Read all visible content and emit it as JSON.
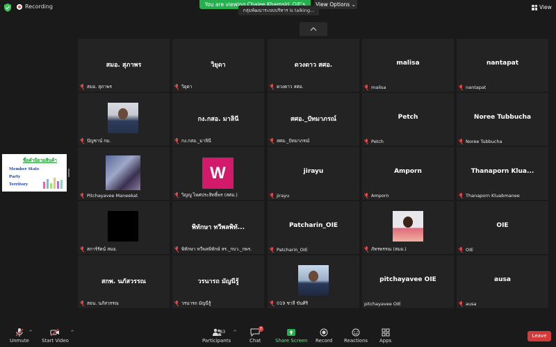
{
  "topbar": {
    "recording_label": "Recording",
    "viewing_banner": "You are viewing Chalee Khamsiri_OIE's screen",
    "view_options_label": "View Options",
    "speaker_tip": "กลุ่มพัฒนาระบบบริหาร is talking...",
    "view_button_label": "View"
  },
  "shared_screen": {
    "title": "ชื่อคำนิยามสินค้า",
    "lines": [
      "Member State",
      "Party",
      "Territory"
    ]
  },
  "tiles": [
    {
      "name": "สมอ. สุภาพร",
      "label": "สมอ. สุภาพร",
      "photo": null
    },
    {
      "name": "วิยุดา",
      "label": "วิยุดา",
      "photo": null
    },
    {
      "name": "ดวงดาว สศอ.",
      "label": "ดวงดาว สศอ.",
      "photo": null
    },
    {
      "name": "malisa",
      "label": "malisa",
      "photo": null
    },
    {
      "name": "nantapat",
      "label": "nantapat",
      "photo": null
    },
    {
      "name": "",
      "label": "ปัญชาน์ กม.",
      "photo": "woman"
    },
    {
      "name": "กง.กสอ. มาลินี",
      "label": "กง.กสอ._มาลินี",
      "photo": null
    },
    {
      "name": "สศอ._ปัทมาภรณ์",
      "label": "สศอ._ปัทมาภรณ์",
      "photo": null
    },
    {
      "name": "Petch",
      "label": "Petch",
      "photo": null
    },
    {
      "name": "Noree Tubbucha",
      "label": "Noree Tubbucha",
      "photo": null
    },
    {
      "name": "",
      "label": "Pitchayavee Maneekat",
      "photo": "group"
    },
    {
      "name": "",
      "label": "วิญญู ไพศประสิทธิ์พร (สศอ.)",
      "photo": "W"
    },
    {
      "name": "jirayu",
      "label": "jirayu",
      "photo": null
    },
    {
      "name": "Amporn",
      "label": "Amporn",
      "photo": null
    },
    {
      "name": "Thanaporn  Klua...",
      "label": "Thanaporn Kluabmanee",
      "photo": null
    },
    {
      "name": "",
      "label": "สการ์รัตน์ สมอ.",
      "photo": "black"
    },
    {
      "name": "พิทักษา ทวีพลพิทั...",
      "label": "พิทักษา ทวีพลพิทักษ์ สร._กบว._กพร.",
      "photo": null
    },
    {
      "name": "Patcharin_OIE",
      "label": "Patcharin_OIE",
      "photo": null
    },
    {
      "name": "",
      "label": "ภัทรพรรณ (สมอ.)",
      "photo": "woman2"
    },
    {
      "name": "OIE",
      "label": "OIE",
      "photo": null
    },
    {
      "name": "สกพ. นภัสวรรณ",
      "label": "สอน. นภัสวรรณ",
      "photo": null
    },
    {
      "name": "วรนารถ มัญนีรู้",
      "label": "วรนารถ มัญนีรู้",
      "photo": null
    },
    {
      "name": "",
      "label": "019 ชาลี ขันศิริ",
      "photo": "man"
    },
    {
      "name": "pitchayavee  OIE",
      "label": "pitchayavee  OIE",
      "photo": null,
      "unmuted": true
    },
    {
      "name": "ausa",
      "label": "ausa",
      "photo": null
    }
  ],
  "toolbar": {
    "unmute_label": "Unmute",
    "start_video_label": "Start Video",
    "participants_label": "Participants",
    "participants_count": "83",
    "chat_label": "Chat",
    "chat_badge": "7",
    "share_screen_label": "Share Screen",
    "record_label": "Record",
    "reactions_label": "Reactions",
    "apps_label": "Apps",
    "leave_label": "Leave"
  },
  "colors": {
    "banner_green": "#24b04e",
    "leave_red": "#d43a3a",
    "tile_bg": "#232323"
  }
}
